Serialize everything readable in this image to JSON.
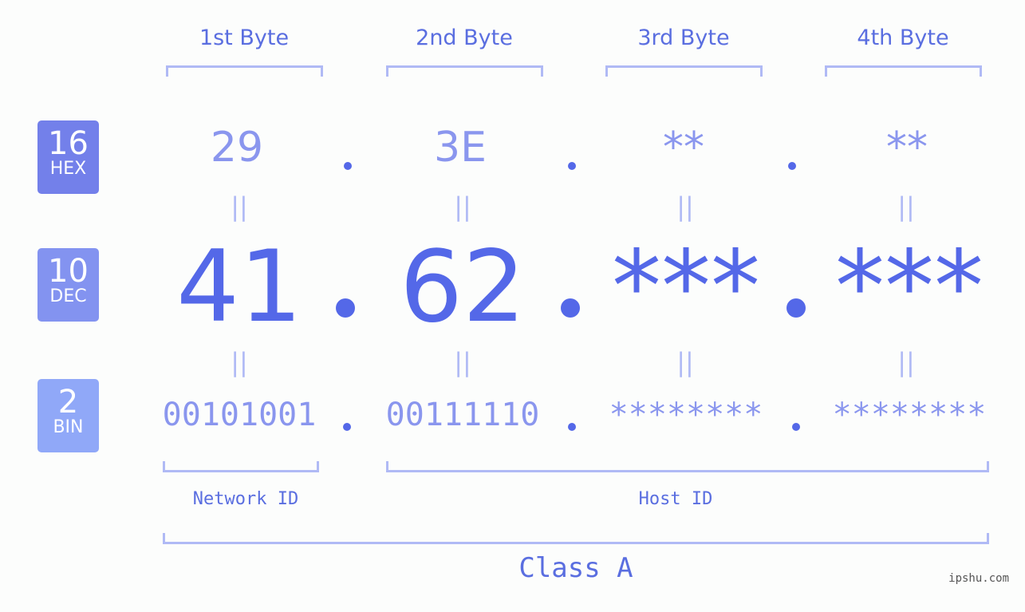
{
  "bytes": [
    "1st Byte",
    "2nd Byte",
    "3rd Byte",
    "4th Byte"
  ],
  "badges": [
    {
      "num": "16",
      "label": "HEX",
      "color": "#7380ea"
    },
    {
      "num": "10",
      "label": "DEC",
      "color": "#8393f0"
    },
    {
      "num": "2",
      "label": "BIN",
      "color": "#90a8f8"
    }
  ],
  "hex": [
    "29",
    "3E",
    "**",
    "**"
  ],
  "dec": [
    "41",
    "62",
    "***",
    "***"
  ],
  "bin": [
    "00101001",
    "00111110",
    "********",
    "********"
  ],
  "equals_sign": "||",
  "network_label": "Network ID",
  "host_label": "Host ID",
  "class_label": "Class A",
  "watermark": "ipshu.com"
}
